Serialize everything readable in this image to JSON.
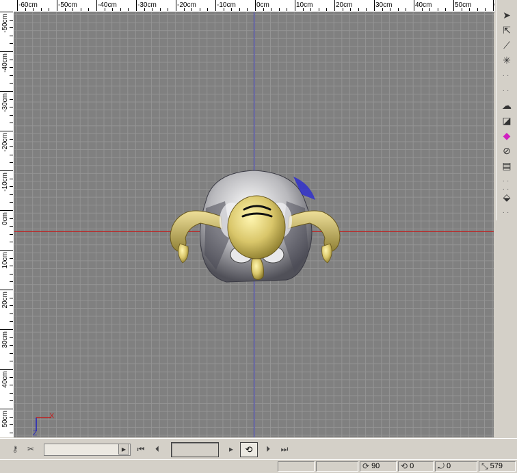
{
  "ruler_top": {
    "labels": [
      "-60cm",
      "-50cm",
      "-40cm",
      "-30cm",
      "-20cm",
      "-10cm",
      "0cm",
      "10cm",
      "20cm",
      "30cm",
      "40cm",
      "50cm",
      "6"
    ]
  },
  "ruler_left": {
    "labels": [
      "-50cm",
      "-40cm",
      "-30cm",
      "-20cm",
      "-10cm",
      "0cm",
      "10cm",
      "20cm",
      "30cm",
      "40cm",
      "50cm"
    ]
  },
  "viewport": {
    "gizmo_x_label": "X",
    "gizmo_z_label": "Z",
    "axis_colors": {
      "x": "#c02020",
      "y": "#2020c0"
    }
  },
  "tools": [
    "select-arrow-icon",
    "add-select-icon",
    "bone-tool-icon",
    "sparkle-tool-icon",
    "dotted-tool-icon",
    "dotted-tool-icon",
    "cloud-shape-icon",
    "shape-edit-icon",
    "paint-icon",
    "rotate-circle-icon",
    "stack-icon",
    "dotted-tool-icon",
    "dotted-tool-icon",
    "diamond-mesh-icon",
    "dotted-tool-icon"
  ],
  "timeline": {
    "frame_value": ""
  },
  "status": {
    "rotate_x": "90",
    "rotate_y": "0",
    "rotate_z": "0",
    "zoom": "579"
  }
}
